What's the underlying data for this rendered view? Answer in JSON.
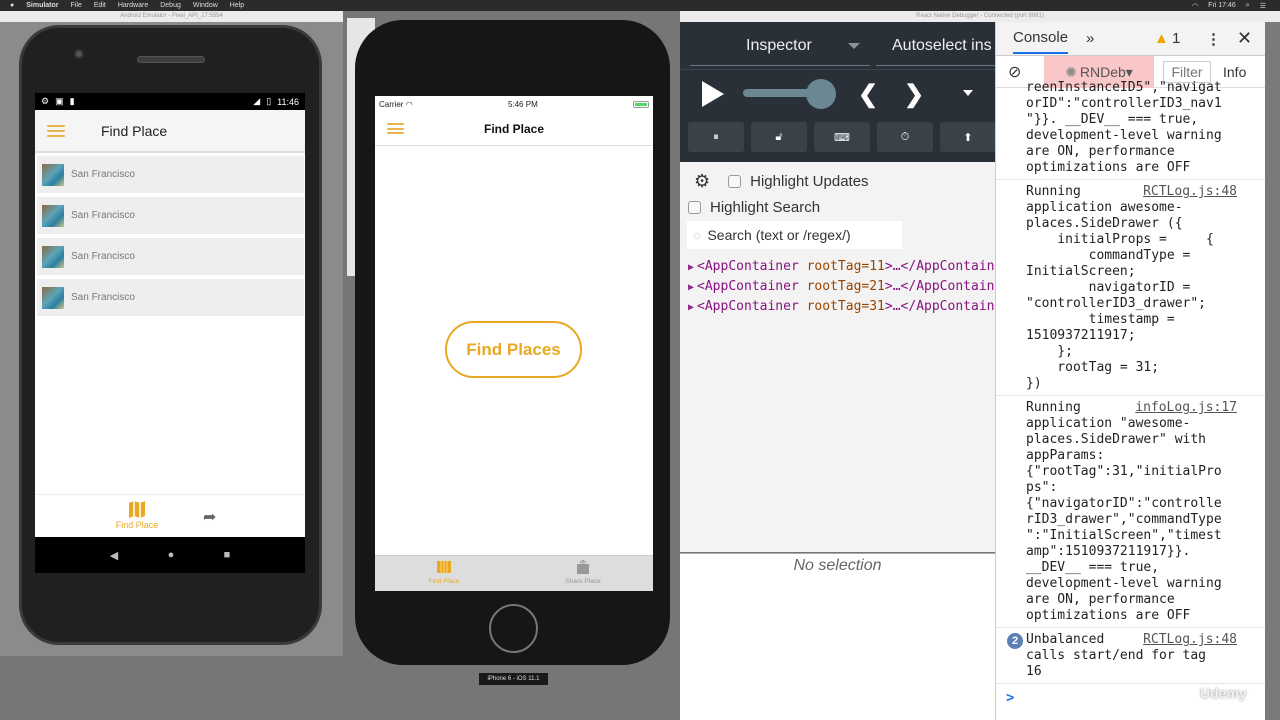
{
  "menubar": {
    "app": "Simulator",
    "items": [
      "File",
      "Edit",
      "Hardware",
      "Debug",
      "Window",
      "Help"
    ],
    "clock": "Fri 17:46"
  },
  "android": {
    "window_title": "Android Emulator - Pixel_API_27:5554",
    "status_time": "11:46",
    "toolbar_title": "Find Place",
    "places": [
      {
        "name": "San Francisco"
      },
      {
        "name": "San Francisco"
      },
      {
        "name": "San Francisco"
      },
      {
        "name": "San Francisco"
      }
    ],
    "tabs": {
      "find": "Find Place"
    }
  },
  "ios": {
    "carrier": "Carrier",
    "time": "5:46 PM",
    "nav_title": "Find Place",
    "button_label": "Find Places",
    "tabs": {
      "find": "Find Place",
      "share": "Share Place"
    },
    "device_label": "iPhone 6 - iOS 11.1",
    "accent": "#e9a823"
  },
  "debugger": {
    "window_title": "React Native Debugger - Connected (port 8081)",
    "inspector_label": "Inspector",
    "autoselect_label": "Autoselect ins",
    "highlight_updates": "Highlight Updates",
    "highlight_search": "Highlight Search",
    "search_placeholder": "Search (text or /regex/)",
    "tree": [
      {
        "tag": "AppContainer",
        "attr": "rootTag",
        "value": "11"
      },
      {
        "tag": "AppContainer",
        "attr": "rootTag",
        "value": "21"
      },
      {
        "tag": "AppContainer",
        "attr": "rootTag",
        "value": "31"
      }
    ],
    "no_selection": "No selection"
  },
  "console": {
    "tab_label": "Console",
    "more": "»",
    "warning_count": "1",
    "context": "RNDeb▾",
    "filter_placeholder": "Filter",
    "level": "Info",
    "entries": [
      {
        "text": "reenInstanceID5\",\"navigat\norID\":\"controllerID3_nav1\n\"}}. __DEV__ === true,\ndevelopment-level warning\nare ON, performance\noptimizations are OFF",
        "source": ""
      },
      {
        "text": "Running\napplication awesome-\nplaces.SideDrawer ({\n    initialProps =     {\n        commandType =\nInitialScreen;\n        navigatorID =\n\"controllerID3_drawer\";\n        timestamp =\n1510937211917;\n    };\n    rootTag = 31;\n})",
        "source": "RCTLog.js:48"
      },
      {
        "text": "Running\napplication \"awesome-\nplaces.SideDrawer\" with\nappParams:\n{\"rootTag\":31,\"initialPro\nps\":\n{\"navigatorID\":\"controlle\nrID3_drawer\",\"commandType\n\":\"InitialScreen\",\"timest\namp\":1510937211917}}.\n__DEV__ === true,\ndevelopment-level warning\nare ON, performance\noptimizations are OFF",
        "source": "infoLog.js:17"
      },
      {
        "text": "Unbalanced\ncalls start/end for tag\n16",
        "source": "RCTLog.js:48",
        "count": "2"
      }
    ],
    "prompt": ">"
  },
  "watermark": "Udemy"
}
